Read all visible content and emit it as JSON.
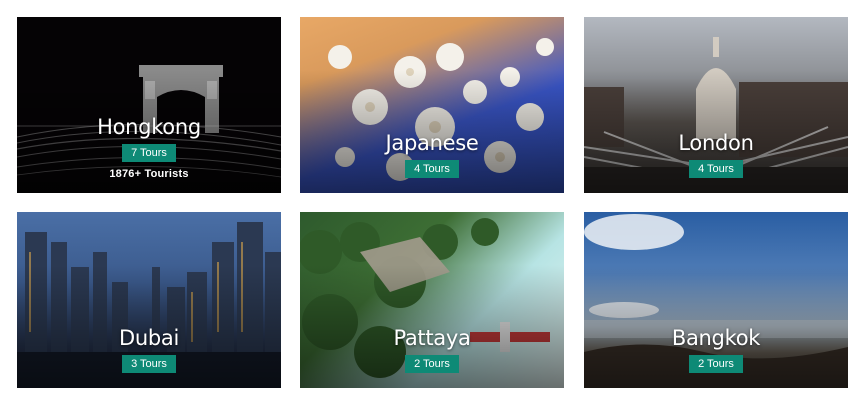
{
  "destinations": [
    {
      "name": "Hongkong",
      "tours": "7 Tours",
      "tourists": "1876+ Tourists"
    },
    {
      "name": "Japanese",
      "tours": "4 Tours"
    },
    {
      "name": "London",
      "tours": "4 Tours"
    },
    {
      "name": "Dubai",
      "tours": "3 Tours"
    },
    {
      "name": "Pattaya",
      "tours": "2 Tours"
    },
    {
      "name": "Bangkok",
      "tours": "2 Tours"
    }
  ],
  "colors": {
    "badge": "#0e8a76"
  }
}
